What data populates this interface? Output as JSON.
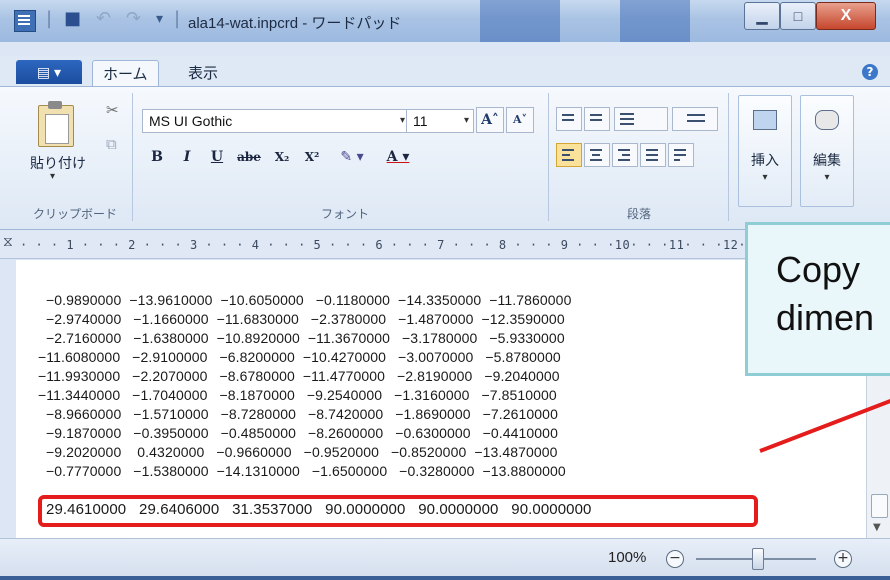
{
  "window": {
    "title": "ala14-wat.inpcrd - ワードパッド",
    "minimize_label": "▁",
    "maximize_label": "□",
    "close_label": "X"
  },
  "quick_access": {
    "separator": "|",
    "save": "■",
    "undo": "↶",
    "redo": "↷",
    "customize": "▾"
  },
  "tabs": {
    "file": "▤ ▾",
    "home": "ホーム",
    "view": "表示",
    "help": "?"
  },
  "ribbon": {
    "clipboard": {
      "paste": "貼り付け",
      "paste_arrow": "▾",
      "cut": "✂",
      "copy": "⧉",
      "group": "クリップボード"
    },
    "font": {
      "family": "MS UI Gothic",
      "size": "11",
      "grow": "A˄",
      "shrink": "A˅",
      "bold": "B",
      "italic": "I",
      "underline": "U",
      "strike": "abe",
      "subscript": "X₂",
      "superscript": "X²",
      "highlight": "✎ ▾",
      "color": "A ▾",
      "group": "フォント"
    },
    "paragraph": {
      "group": "段落"
    },
    "insert": {
      "label": "挿入",
      "arrow": "▾"
    },
    "edit": {
      "label": "編集",
      "arrow": "▾"
    }
  },
  "ruler": {
    "scale": "· · · 1 · · · 2 · · · 3 · · · 4 · · · 5 · · · 6 · · · 7 · · · 8 · · · 9 · · ·10· · ·11· · ·12· · ·13·",
    "marker": "⧖"
  },
  "document": {
    "lines": [
      "  −0.9890000  −13.9610000  −10.6050000   −0.1180000  −14.3350000  −11.7860000",
      "  −2.9740000   −1.1660000  −11.6830000   −2.3780000   −1.4870000  −12.3590000",
      "  −2.7160000   −1.6380000  −10.8920000  −11.3670000   −3.1780000   −5.9330000",
      "−11.6080000   −2.9100000   −6.8200000  −10.4270000   −3.0070000   −5.8780000",
      "−11.9930000   −2.2070000   −8.6780000  −11.4770000   −2.8190000   −9.2040000",
      "−11.3440000   −1.7040000   −8.1870000   −9.2540000   −1.3160000   −7.8510000",
      "  −8.9660000   −1.5710000   −8.7280000   −8.7420000   −1.8690000   −7.2610000",
      "  −9.1870000   −0.3950000   −0.4850000   −8.2600000   −0.6300000   −0.4410000",
      "  −9.2020000    0.4320000   −0.9660000   −0.9520000   −0.8520000  −13.4870000",
      "  −0.7770000   −1.5380000  −14.1310000   −1.6500000   −0.3280000  −13.8800000"
    ],
    "box_line": "29.4610000   29.6406000   31.3537000   90.0000000   90.0000000   90.0000000"
  },
  "callout": {
    "line1": "Copy",
    "line2": "dimen"
  },
  "status": {
    "zoom": "100%",
    "zoom_out": "−",
    "zoom_in": "+",
    "zoom_level_percent": 100
  }
}
